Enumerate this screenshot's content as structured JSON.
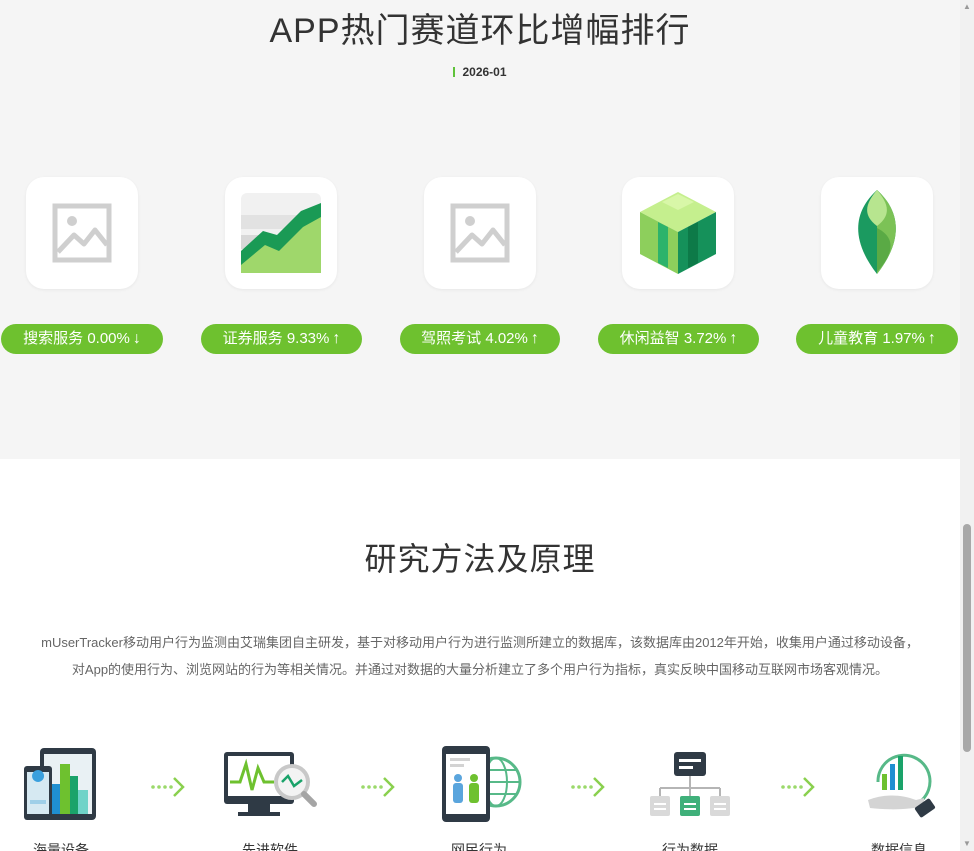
{
  "ranking": {
    "title": "APP热门赛道环比增幅排行",
    "period": "2026-01",
    "items": [
      {
        "name": "搜索服务",
        "change": "0.00%",
        "arrow": "↓",
        "icon": "image-placeholder-icon"
      },
      {
        "name": "证券服务",
        "change": "9.33%",
        "arrow": "↑",
        "icon": "stock-chart-app-icon"
      },
      {
        "name": "驾照考试",
        "change": "4.02%",
        "arrow": "↑",
        "icon": "image-placeholder-icon"
      },
      {
        "name": "休闲益智",
        "change": "3.72%",
        "arrow": "↑",
        "icon": "green-cube-app-icon"
      },
      {
        "name": "儿童教育",
        "change": "1.97%",
        "arrow": "↑",
        "icon": "green-leaf-app-icon"
      }
    ]
  },
  "method": {
    "title": "研究方法及原理",
    "description_line1": "mUserTracker移动用户行为监测由艾瑞集团自主研发，基于对移动用户行为进行监测所建立的数据库，该数据库由2012年开始，收集用户通过移动设备，",
    "description_line2": "对App的使用行为、浏览网站的行为等相关情况。并通过对数据的大量分析建立了多个用户行为指标，真实反映中国移动互联网市场客观情况。",
    "steps": [
      {
        "label": "海量设备",
        "icon": "devices-icon"
      },
      {
        "label": "先进软件",
        "icon": "monitor-analysis-icon"
      },
      {
        "label": "网民行为",
        "icon": "phone-users-globe-icon"
      },
      {
        "label": "行为数据",
        "icon": "hierarchy-data-icon"
      },
      {
        "label": "数据信息",
        "icon": "hand-chart-icon"
      }
    ]
  },
  "colors": {
    "accent_green": "#6ec12f",
    "section_bg": "#f5f5f5"
  }
}
